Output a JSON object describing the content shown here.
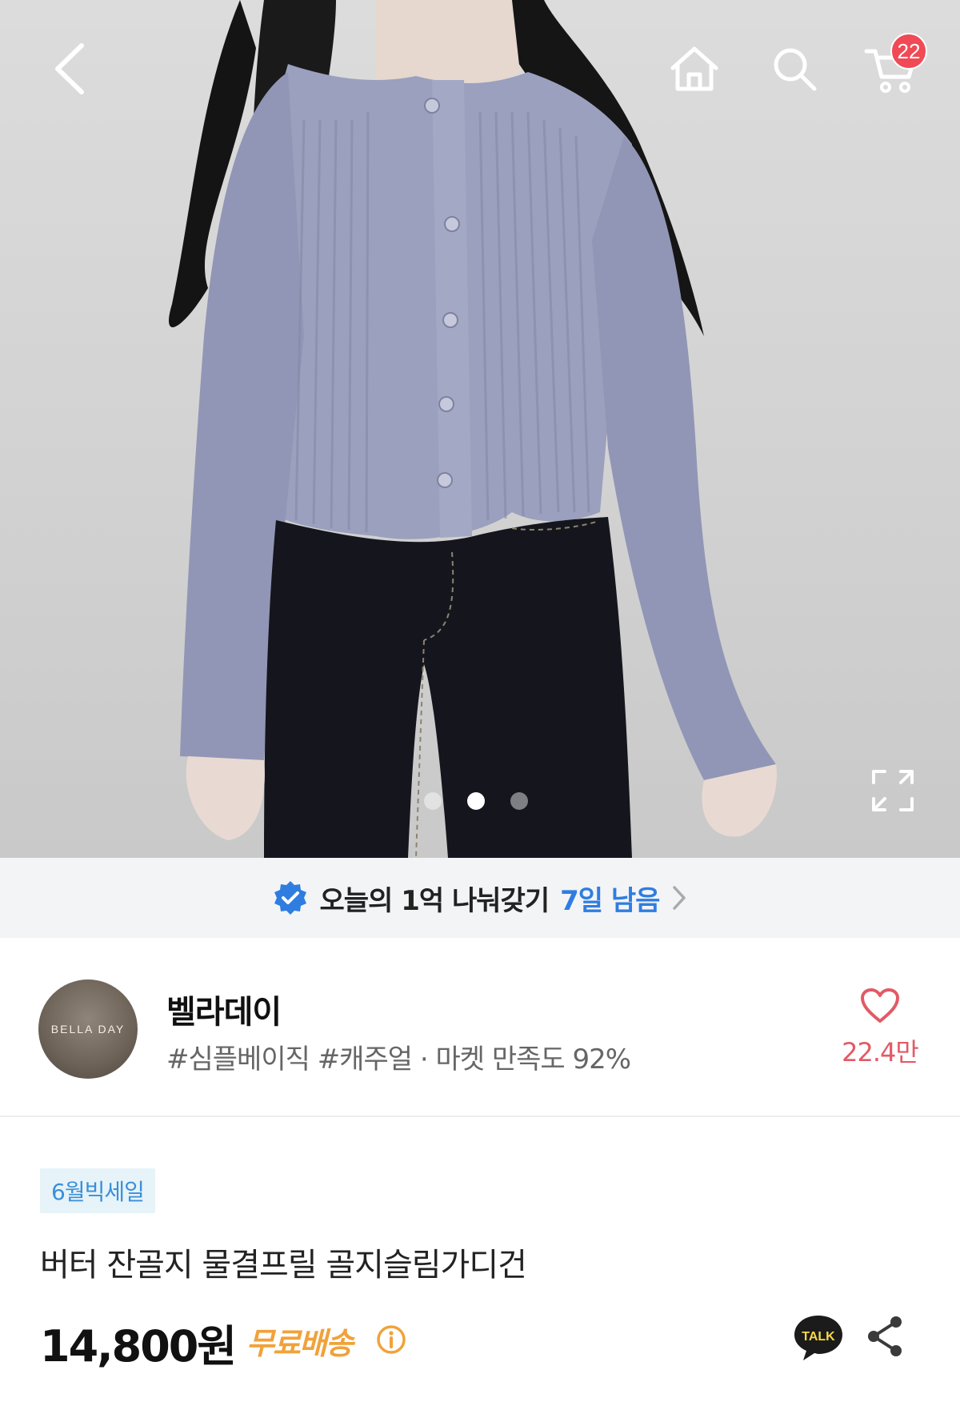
{
  "colors": {
    "accent_blue": "#2f7de1",
    "badge_red": "#ef4a55",
    "like_pink": "#e25a66",
    "shipping_orange": "#f0a23a"
  },
  "header": {
    "back_icon": "chevron-left-icon",
    "home_icon": "home-icon",
    "search_icon": "search-icon",
    "cart_icon": "cart-icon",
    "cart_count": "22"
  },
  "gallery": {
    "image": "product-photo",
    "active_index": 2,
    "total": 3,
    "expand_icon": "expand-icon"
  },
  "promo": {
    "icon": "verified-badge-icon",
    "text": "오늘의 1억 나눠갖기",
    "remaining": "7일 남음"
  },
  "store": {
    "avatar_text": "BELLA DAY",
    "name": "벨라데이",
    "tags": "#심플베이직 #캐주얼 · 마켓 만족도 92%",
    "like_count": "22.4만"
  },
  "product": {
    "sale_badge": "6월빅세일",
    "title": "버터 잔골지 물결프릴 골지슬림가디건",
    "price": "14,800원",
    "shipping": "무료배송",
    "talk_label": "TALK"
  }
}
